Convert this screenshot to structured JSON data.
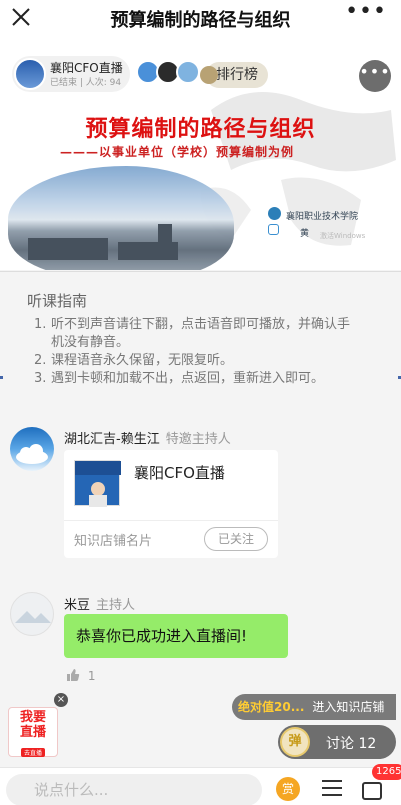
{
  "topbar": {
    "title": "预算编制的路径与组织",
    "close_icon": "close-icon",
    "more_glyph": "•••"
  },
  "banner": {
    "channel_name": "襄阳CFO直播",
    "channel_meta": "已结束 | 人次: 94",
    "rank_label": "排行榜",
    "more_glyph": "•••",
    "slide_title": "预算编制的路径与组织",
    "slide_subtitle": "———以事业单位（学校）预算编制为例",
    "school_name": "襄阳职业技术学院",
    "presenter": "黄",
    "watermark": "激活Windows"
  },
  "guide": {
    "heading": "听课指南",
    "items": [
      {
        "n": "1.",
        "text": "听不到声音请往下翻，点击语音即可播放，并确认手机没有静音。"
      },
      {
        "n": "2.",
        "text": "课程语音永久保留，无限复听。"
      },
      {
        "n": "3.",
        "text": "遇到卡顿和加载不出，点返回，重新进入即可。"
      }
    ]
  },
  "messages": [
    {
      "name": "湖北汇吉-赖生江",
      "role": "特邀主持人",
      "card": {
        "title": "襄阳CFO直播",
        "footer": "知识店铺名片",
        "follow_label": "已关注"
      }
    },
    {
      "name": "米豆",
      "role": "主持人",
      "text": "恭喜你已成功进入直播间!",
      "likes": "1"
    }
  ],
  "floating": {
    "live_badge_line1": "我要",
    "live_badge_line2": "直播",
    "live_badge_sub": "去直播",
    "promo_highlight": "绝对值20...",
    "promo_action": "进入知识店铺",
    "danmu_label": "弹",
    "discuss_label": "讨论 12"
  },
  "bottombar": {
    "input_placeholder": "说点什么...",
    "reward_label": "赏",
    "gift_badge": "1265"
  },
  "colors": {
    "accent_green": "#95ec69",
    "title_red": "#d11111",
    "badge_red": "#ff3333"
  }
}
